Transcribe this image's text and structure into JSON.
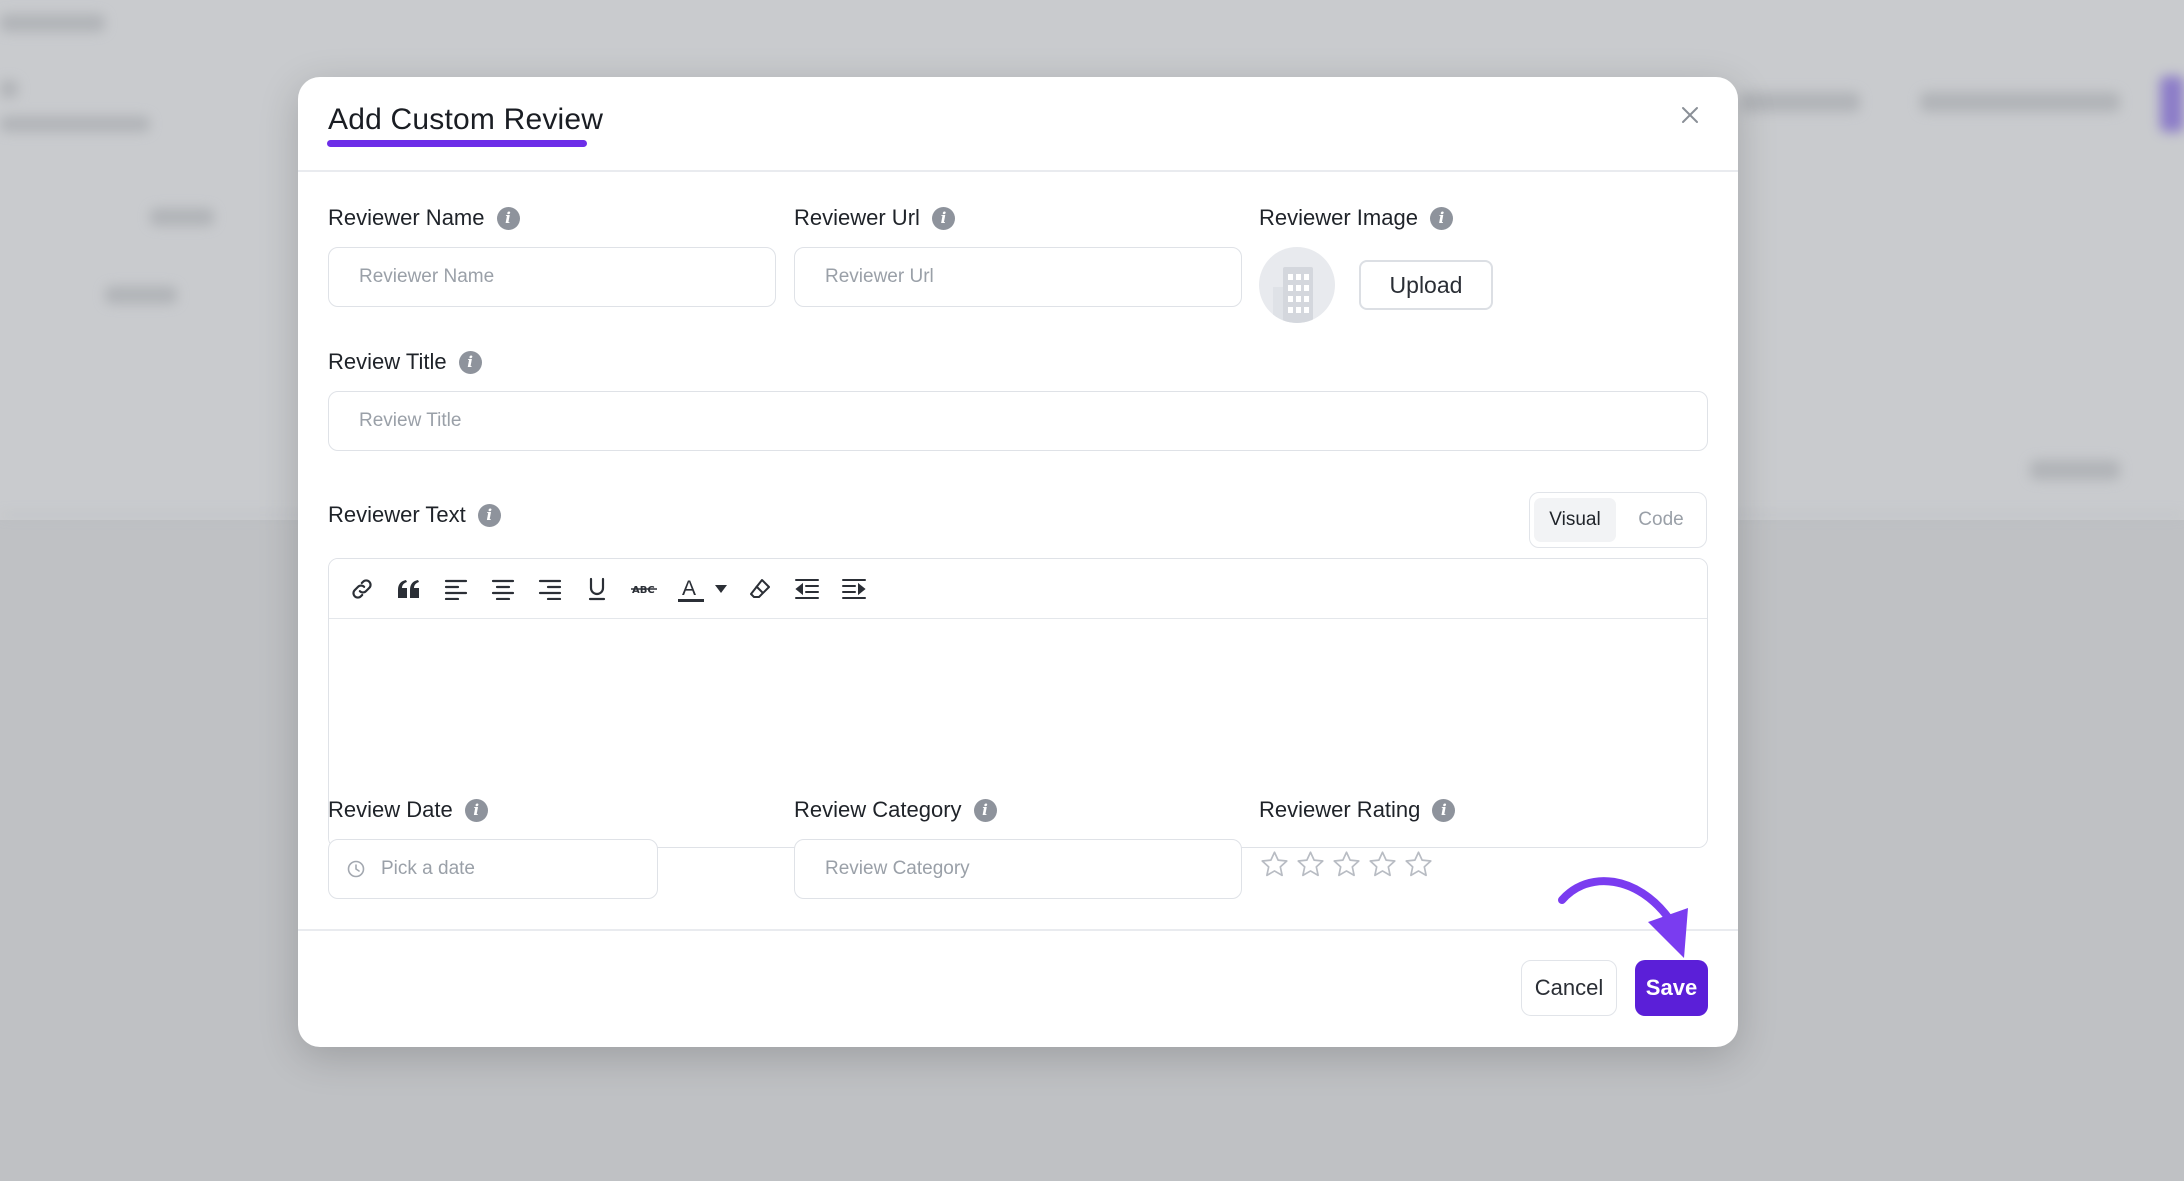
{
  "modal": {
    "title": "Add Custom Review",
    "accent_color": "#6d2ee8",
    "primary_color": "#5b1fd8"
  },
  "fields": {
    "reviewer_name": {
      "label": "Reviewer Name",
      "placeholder": "Reviewer Name",
      "value": ""
    },
    "reviewer_url": {
      "label": "Reviewer Url",
      "placeholder": "Reviewer Url",
      "value": ""
    },
    "reviewer_image": {
      "label": "Reviewer Image",
      "upload_label": "Upload"
    },
    "review_title": {
      "label": "Review Title",
      "placeholder": "Review Title",
      "value": ""
    },
    "reviewer_text": {
      "label": "Reviewer Text",
      "modes": [
        "Visual",
        "Code"
      ],
      "active_mode": "Visual",
      "value": ""
    },
    "review_date": {
      "label": "Review Date",
      "placeholder": "Pick a date",
      "value": ""
    },
    "review_category": {
      "label": "Review Category",
      "placeholder": "Review Category",
      "value": ""
    },
    "reviewer_rating": {
      "label": "Reviewer Rating",
      "max": 5,
      "value": 0
    }
  },
  "toolbar_icons": [
    "link-icon",
    "quote-icon",
    "align-left-icon",
    "align-center-icon",
    "align-right-icon",
    "underline-icon",
    "strikethrough-icon",
    "text-color-icon",
    "eraser-icon",
    "outdent-icon",
    "indent-icon"
  ],
  "footer": {
    "cancel_label": "Cancel",
    "save_label": "Save"
  }
}
